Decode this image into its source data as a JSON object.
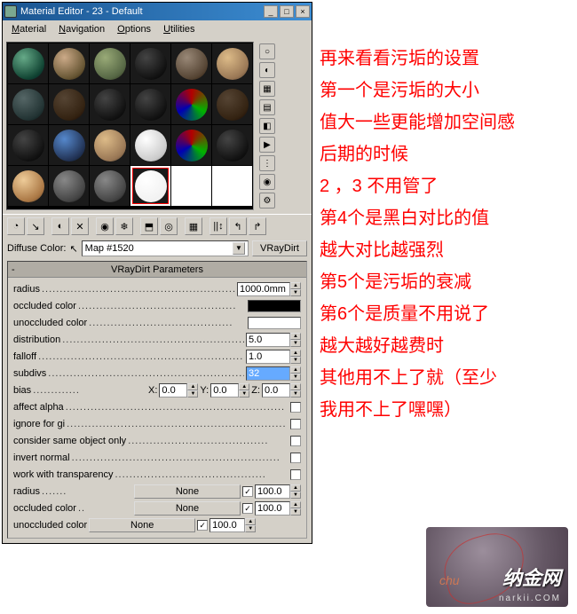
{
  "title": "Material Editor - 23 - Default",
  "menu": {
    "m1": "Material",
    "m2": "Navigation",
    "m3": "Options",
    "m4": "Utilities"
  },
  "diffuse_label": "Diffuse Color:",
  "map_name": "Map #1520",
  "map_type": "VRayDirt",
  "panel_title": "VRayDirt Parameters",
  "params": {
    "radius_l": "radius",
    "radius_v": "1000.0mm",
    "ocl_l": "occluded color",
    "ocl_c": "#000000",
    "unocl_l": "unoccluded color",
    "unocl_c": "#ffffff",
    "dist_l": "distribution",
    "dist_v": "5.0",
    "fall_l": "falloff",
    "fall_v": "1.0",
    "subd_l": "subdivs",
    "subd_v": "32",
    "bias_l": "bias",
    "bx": "0.0",
    "by": "0.0",
    "bz": "0.0",
    "aff_l": "affect alpha",
    "ign_l": "ignore for gi",
    "same_l": "consider same object only",
    "inv_l": "invert normal",
    "trans_l": "work with transparency",
    "r2_l": "radius",
    "r2_v": "100.0",
    "oc2_l": "occluded color",
    "oc2_v": "100.0",
    "un2_l": "unoccluded color",
    "un2_v": "100.0",
    "none": "None"
  },
  "annot": [
    "再来看看污垢的设置",
    "第一个是污垢的大小",
    "值大一些更能增加空间感",
    "后期的时候",
    "2 ，3 不用管了",
    "第4个是黑白对比的值",
    "越大对比越强烈",
    "第5个是污垢的衰减",
    "第6个是质量不用说了",
    "越大越好越费时",
    "其他用不上了就（至少",
    "我用不上了嘿嘿）"
  ],
  "wm": {
    "sig": "chu",
    "brand": "纳金网",
    "url": "narkii.COM"
  }
}
